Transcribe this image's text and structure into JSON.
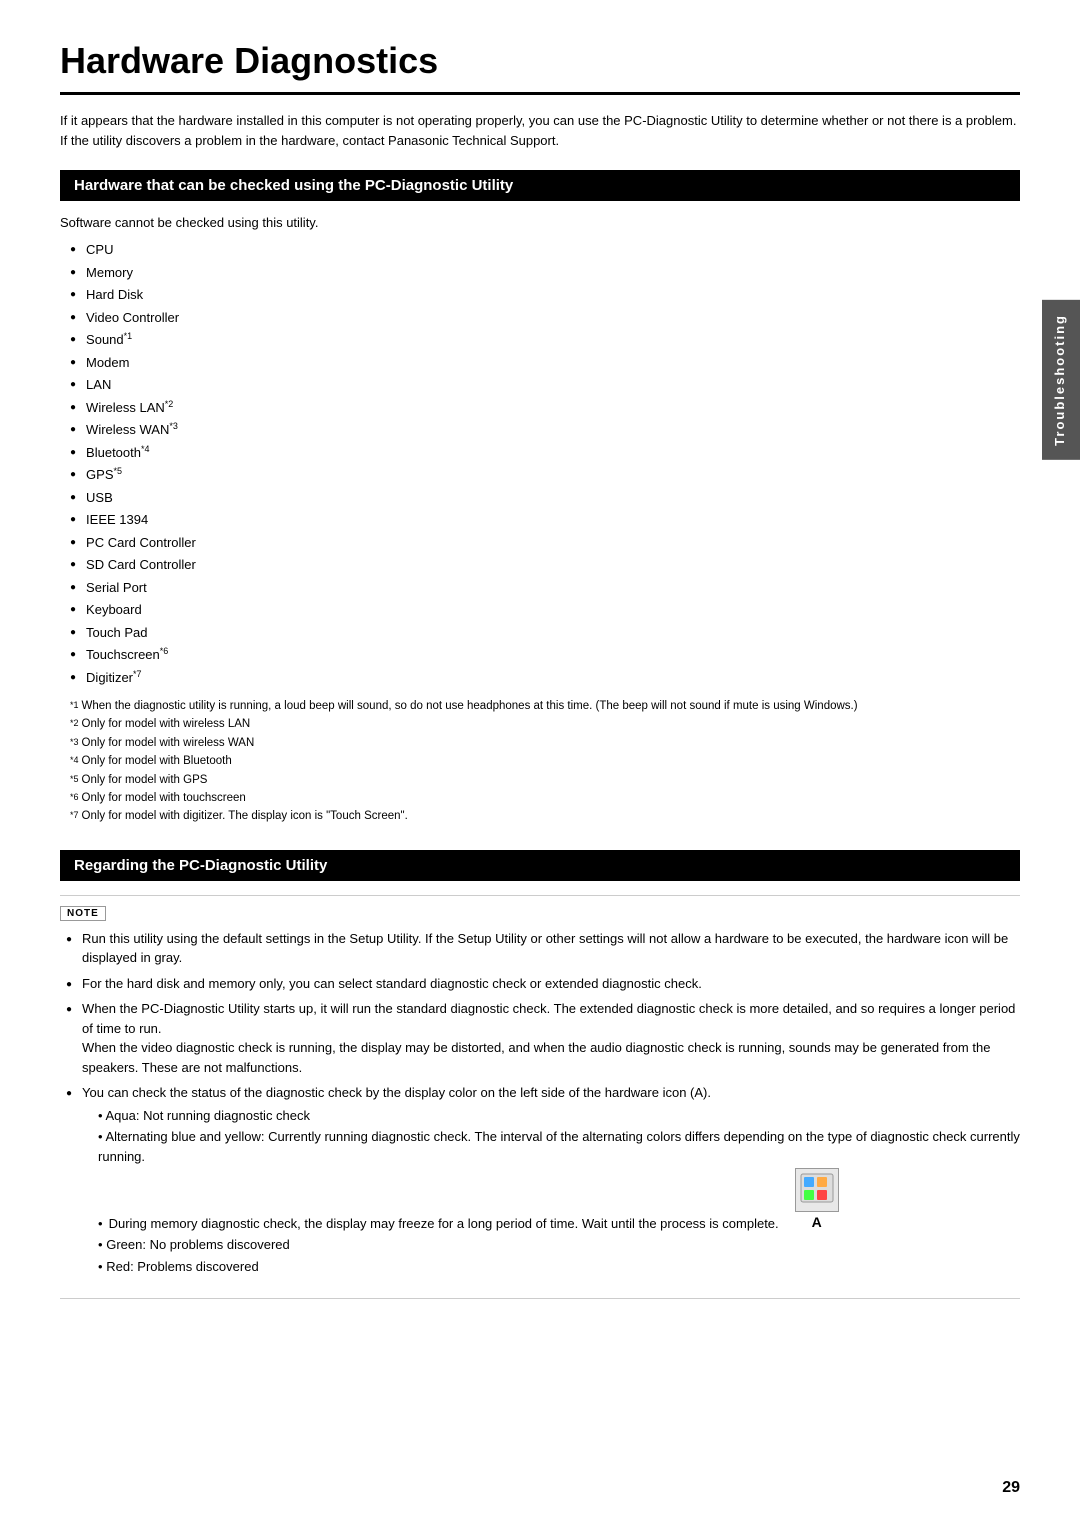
{
  "page": {
    "title": "Hardware Diagnostics",
    "page_number": "29",
    "sidebar_label": "Troubleshooting"
  },
  "intro": {
    "line1": "If it appears that the hardware installed in this computer is not operating properly, you can use the PC-Diagnostic Utility to determine whether or not there is a problem.",
    "line2": "If the utility discovers a problem in the hardware, contact Panasonic Technical Support."
  },
  "section1": {
    "header": "Hardware that can be checked using the PC-Diagnostic Utility",
    "software_note": "Software cannot be checked using this utility.",
    "items": [
      {
        "label": "CPU",
        "superscript": ""
      },
      {
        "label": "Memory",
        "superscript": ""
      },
      {
        "label": "Hard Disk",
        "superscript": ""
      },
      {
        "label": "Video Controller",
        "superscript": ""
      },
      {
        "label": "Sound",
        "superscript": "*1"
      },
      {
        "label": "Modem",
        "superscript": ""
      },
      {
        "label": "LAN",
        "superscript": ""
      },
      {
        "label": "Wireless LAN",
        "superscript": "*2"
      },
      {
        "label": "Wireless WAN",
        "superscript": "*3"
      },
      {
        "label": "Bluetooth",
        "superscript": "*4"
      },
      {
        "label": "GPS",
        "superscript": "*5"
      },
      {
        "label": "USB",
        "superscript": ""
      },
      {
        "label": "IEEE 1394",
        "superscript": ""
      },
      {
        "label": "PC Card Controller",
        "superscript": ""
      },
      {
        "label": "SD Card Controller",
        "superscript": ""
      },
      {
        "label": "Serial Port",
        "superscript": ""
      },
      {
        "label": "Keyboard",
        "superscript": ""
      },
      {
        "label": "Touch Pad",
        "superscript": ""
      },
      {
        "label": "Touchscreen",
        "superscript": "*6"
      },
      {
        "label": "Digitizer",
        "superscript": "*7"
      }
    ],
    "footnotes": [
      {
        "num": "*1",
        "text": "When the diagnostic utility is running, a loud beep will sound, so do not use headphones at this time. (The beep will not sound if mute is using Windows.)"
      },
      {
        "num": "*2",
        "text": "Only for model with wireless LAN"
      },
      {
        "num": "*3",
        "text": "Only for model with wireless WAN"
      },
      {
        "num": "*4",
        "text": "Only for model with Bluetooth"
      },
      {
        "num": "*5",
        "text": "Only for model with GPS"
      },
      {
        "num": "*6",
        "text": "Only for model with touchscreen"
      },
      {
        "num": "*7",
        "text": "Only for model with digitizer. The display icon is \"Touch Screen\"."
      }
    ]
  },
  "section2": {
    "header": "Regarding the PC-Diagnostic Utility",
    "note_label": "NOTE",
    "note_items": [
      {
        "text": "Run this utility using the default settings in the Setup Utility. If the Setup Utility or other settings will not allow a hardware to be executed, the hardware icon will be displayed in gray."
      },
      {
        "text": "For the hard disk and memory only, you can select standard diagnostic check or extended diagnostic check."
      },
      {
        "text": "When the PC-Diagnostic Utility starts up, it will run the standard diagnostic check. The extended diagnostic check is more detailed, and so requires a longer period of time to run.",
        "extra": "When the video diagnostic check is running, the display may be distorted, and when the audio diagnostic check is running, sounds may be generated from the speakers. These are not malfunctions."
      },
      {
        "text": "You can check the status of the diagnostic check by the display color on the left side of the hardware icon (A).",
        "subitems": [
          "Aqua: Not running diagnostic check",
          "Alternating blue and yellow: Currently running diagnostic check. The interval of the alternating colors differs depending on the type of diagnostic check currently running.",
          "During memory diagnostic check, the display may freeze for a long period of time. Wait until the process is complete.",
          "Green: No problems discovered",
          "Red: Problems discovered"
        ]
      }
    ]
  }
}
